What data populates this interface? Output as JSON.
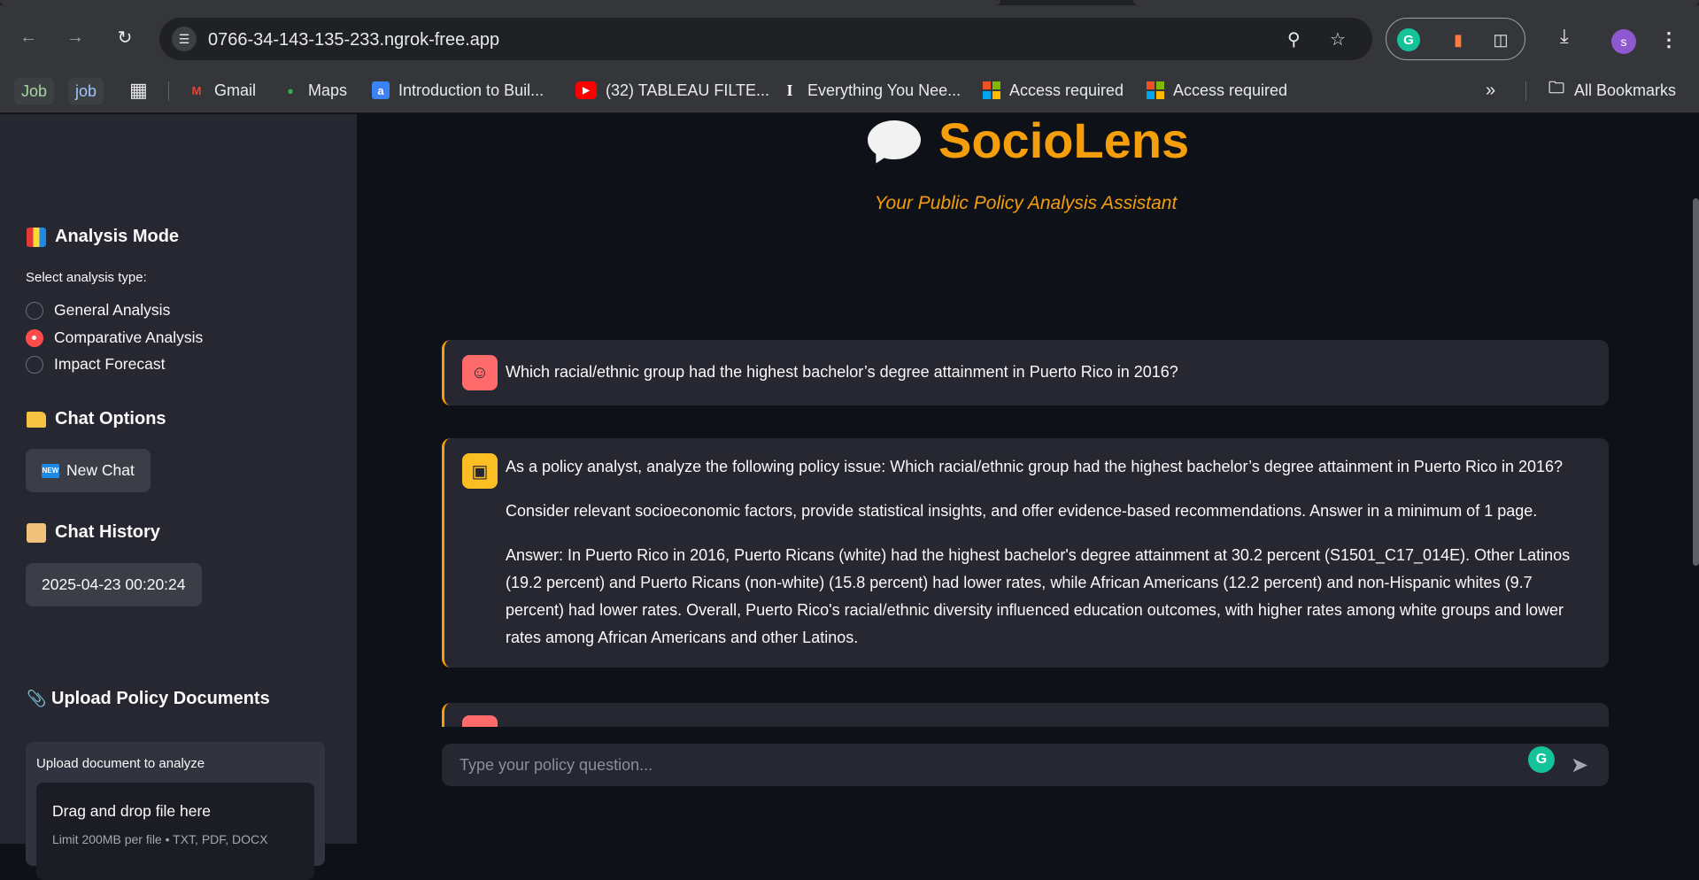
{
  "browser": {
    "url": "0766-34-143-135-233.ngrok-free.app",
    "profile_initial": "s",
    "bookmarks": [
      {
        "label": "Job",
        "icon": "job-chip"
      },
      {
        "label": "job",
        "icon": "job-chip"
      },
      {
        "label": "Gmail",
        "icon": "gmail-icon"
      },
      {
        "label": "Maps",
        "icon": "maps-icon"
      },
      {
        "label": "Introduction to Buil...",
        "icon": "a-icon"
      },
      {
        "label": "(32) TABLEAU FILTE...",
        "icon": "youtube-icon"
      },
      {
        "label": "Everything You Nee...",
        "icon": "i-icon"
      },
      {
        "label": "Access required",
        "icon": "microsoft-icon"
      },
      {
        "label": "Access required",
        "icon": "microsoft-icon"
      }
    ],
    "all_bookmarks": "All Bookmarks"
  },
  "sidebar": {
    "analysis_mode": {
      "heading": "Analysis Mode",
      "select_label": "Select analysis type:",
      "options": [
        "General Analysis",
        "Comparative Analysis",
        "Impact Forecast"
      ],
      "selected": "Comparative Analysis"
    },
    "chat_options": {
      "heading": "Chat Options",
      "new_chat": "New Chat",
      "new_tag": "NEW"
    },
    "chat_history": {
      "heading": "Chat History",
      "items": [
        "2025-04-23 00:20:24"
      ]
    },
    "upload": {
      "heading": "Upload Policy Documents",
      "caption": "Upload document to analyze",
      "drop_text": "Drag and drop file here",
      "limit_text": "Limit 200MB per file • TXT, PDF, DOCX"
    }
  },
  "main": {
    "title": "SocioLens",
    "subtitle": "Your Public Policy Analysis Assistant",
    "messages": [
      {
        "role": "user",
        "text": "Which racial/ethnic group had the highest bachelor’s degree attainment in Puerto Rico in 2016?"
      },
      {
        "role": "assistant",
        "paragraphs": [
          "As a policy analyst, analyze the following policy issue: Which racial/ethnic group had the highest bachelor’s degree attainment in Puerto Rico in 2016?",
          "Consider relevant socioeconomic factors, provide statistical insights, and offer evidence-based recommendations. Answer in a minimum of 1 page.",
          "Answer: In Puerto Rico in 2016, Puerto Ricans (white) had the highest bachelor's degree attainment at 30.2 percent (S1501_C17_014E). Other Latinos (19.2 percent) and Puerto Ricans (non-white) (15.8 percent) had lower rates, while African Americans (12.2 percent) and non-Hispanic whites (9.7 percent) had lower rates. Overall, Puerto Rico's racial/ethnic diversity influenced education outcomes, with higher rates among white groups and lower rates among African Americans and other Latinos."
        ]
      },
      {
        "role": "user",
        "text": ""
      }
    ],
    "input_placeholder": "Type your policy question..."
  },
  "colors": {
    "accent": "#f59e0b",
    "radio_selected": "#ff4b4b",
    "sidebar_bg": "#262730",
    "main_bg": "#0e1117"
  }
}
